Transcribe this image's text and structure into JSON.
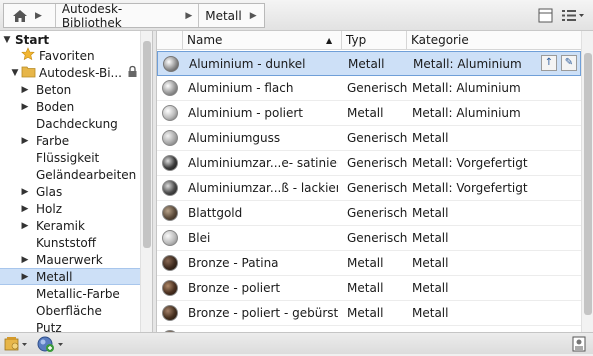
{
  "breadcrumb": {
    "home_icon": "home-icon",
    "library": "Autodesk-Bibliothek",
    "current": "Metall"
  },
  "toolbar": {
    "view_icon": "panel-view-icon",
    "list_icon": "list-view-icon"
  },
  "tree": {
    "items": [
      {
        "label": "Start",
        "level": 0,
        "expanded": true,
        "icon": "none",
        "bold": true
      },
      {
        "label": "Favoriten",
        "level": 1,
        "icon": "star-icon"
      },
      {
        "label": "Autodesk-Bi...",
        "level": 1,
        "expanded": true,
        "icon": "folder-icon",
        "locked": true
      },
      {
        "label": "Beton",
        "level": 2,
        "collapsed": true
      },
      {
        "label": "Boden",
        "level": 2,
        "collapsed": true
      },
      {
        "label": "Dachdeckung",
        "level": 2
      },
      {
        "label": "Farbe",
        "level": 2,
        "collapsed": true
      },
      {
        "label": "Flüssigkeit",
        "level": 2
      },
      {
        "label": "Geländearbeiten",
        "level": 2
      },
      {
        "label": "Glas",
        "level": 2,
        "collapsed": true
      },
      {
        "label": "Holz",
        "level": 2,
        "collapsed": true
      },
      {
        "label": "Keramik",
        "level": 2,
        "collapsed": true
      },
      {
        "label": "Kunststoff",
        "level": 2
      },
      {
        "label": "Mauerwerk",
        "level": 2,
        "collapsed": true
      },
      {
        "label": "Metall",
        "level": 2,
        "collapsed": true,
        "selected": true
      },
      {
        "label": "Metallic-Farbe",
        "level": 2
      },
      {
        "label": "Oberfläche",
        "level": 2
      },
      {
        "label": "Putz",
        "level": 2
      }
    ]
  },
  "table": {
    "columns": [
      "Name",
      "Typ",
      "Kategorie"
    ],
    "sort_indicator": "▲",
    "rows": [
      {
        "name": "Aluminium - dunkel",
        "typ": "Metall",
        "kategorie": "Metall: Aluminium",
        "swatch": "#6a6a6a",
        "selected": true
      },
      {
        "name": "Aluminium - flach",
        "typ": "Generisch",
        "kategorie": "Metall:  Aluminium",
        "swatch": "#9a9a9a"
      },
      {
        "name": "Aluminium - poliert",
        "typ": "Metall",
        "kategorie": "Metall:  Aluminium",
        "swatch": "#bcbcbc"
      },
      {
        "name": "Aluminiumguss",
        "typ": "Generisch",
        "kategorie": "Metall",
        "swatch": "#a8a8a8"
      },
      {
        "name": "Aluminiumzar...e- satiniert",
        "typ": "Generisch",
        "kategorie": "Metall: Vorgefertigt",
        "swatch": "#3a3a3a"
      },
      {
        "name": "Aluminiumzar...ß - lackiert",
        "typ": "Generisch",
        "kategorie": "Metall: Vorgefertigt",
        "swatch": "#4a4a4a"
      },
      {
        "name": "Blattgold",
        "typ": "Generisch",
        "kategorie": "Metall",
        "swatch": "#5a4a3a"
      },
      {
        "name": "Blei",
        "typ": "Generisch",
        "kategorie": "Metall",
        "swatch": "#b8b8b8"
      },
      {
        "name": "Bronze - Patina",
        "typ": "Metall",
        "kategorie": "Metall",
        "swatch": "#3d2a1e"
      },
      {
        "name": "Bronze - poliert",
        "typ": "Metall",
        "kategorie": "Metall",
        "swatch": "#4a3020"
      },
      {
        "name": "Bronze - poliert - gebürstet",
        "typ": "Metall",
        "kategorie": "Metall",
        "swatch": "#45301f"
      },
      {
        "name": "",
        "typ": "",
        "kategorie": "",
        "swatch": "#6a5a4a"
      }
    ]
  },
  "row_actions": {
    "up_icon": "arrow-up-icon",
    "edit_icon": "edit-icon"
  },
  "bottom": {
    "library_icon": "library-icon",
    "add_material_icon": "add-material-icon",
    "detail_icon": "detail-panel-icon"
  }
}
